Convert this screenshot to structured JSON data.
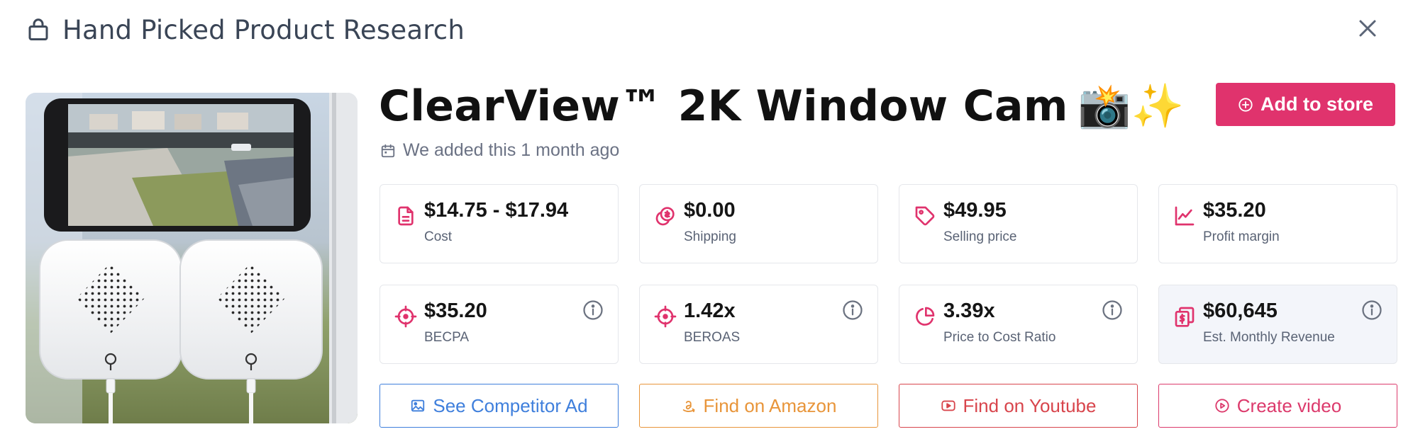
{
  "header": {
    "title": "Hand Picked Product Research",
    "icon": "shopping-bag-icon",
    "close_icon": "close-icon"
  },
  "product": {
    "name": "ClearView™ 2K Window Cam",
    "emoji": "📸✨",
    "added_text": "We added this 1 month ago",
    "add_to_store_label": "Add to store"
  },
  "stats": [
    {
      "value": "$14.75 - $17.94",
      "label": "Cost",
      "icon": "document-icon",
      "info": false
    },
    {
      "value": "$0.00",
      "label": "Shipping",
      "icon": "coins-icon",
      "info": false
    },
    {
      "value": "$49.95",
      "label": "Selling price",
      "icon": "tag-icon",
      "info": false
    },
    {
      "value": "$35.20",
      "label": "Profit margin",
      "icon": "line-chart-icon",
      "info": false
    },
    {
      "value": "$35.20",
      "label": "BECPA",
      "icon": "crosshair-icon",
      "info": true
    },
    {
      "value": "1.42x",
      "label": "BEROAS",
      "icon": "crosshair-icon",
      "info": true
    },
    {
      "value": "3.39x",
      "label": "Price to Cost Ratio",
      "icon": "pie-chart-icon",
      "info": true
    },
    {
      "value": "$60,645",
      "label": "Est. Monthly Revenue",
      "icon": "revenue-icon",
      "info": true
    }
  ],
  "actions": [
    {
      "label": "See Competitor Ad",
      "icon": "image-icon",
      "color": "#3f7fdc"
    },
    {
      "label": "Find on Amazon",
      "icon": "amazon-icon",
      "color": "#e8953a"
    },
    {
      "label": "Find on Youtube",
      "icon": "youtube-icon",
      "color": "#d8454c"
    },
    {
      "label": "Create video",
      "icon": "play-circle-icon",
      "color": "#dc3a6c"
    }
  ],
  "colors": {
    "accent": "#e0336d",
    "title": "#3a4556",
    "muted": "#6b7284"
  }
}
